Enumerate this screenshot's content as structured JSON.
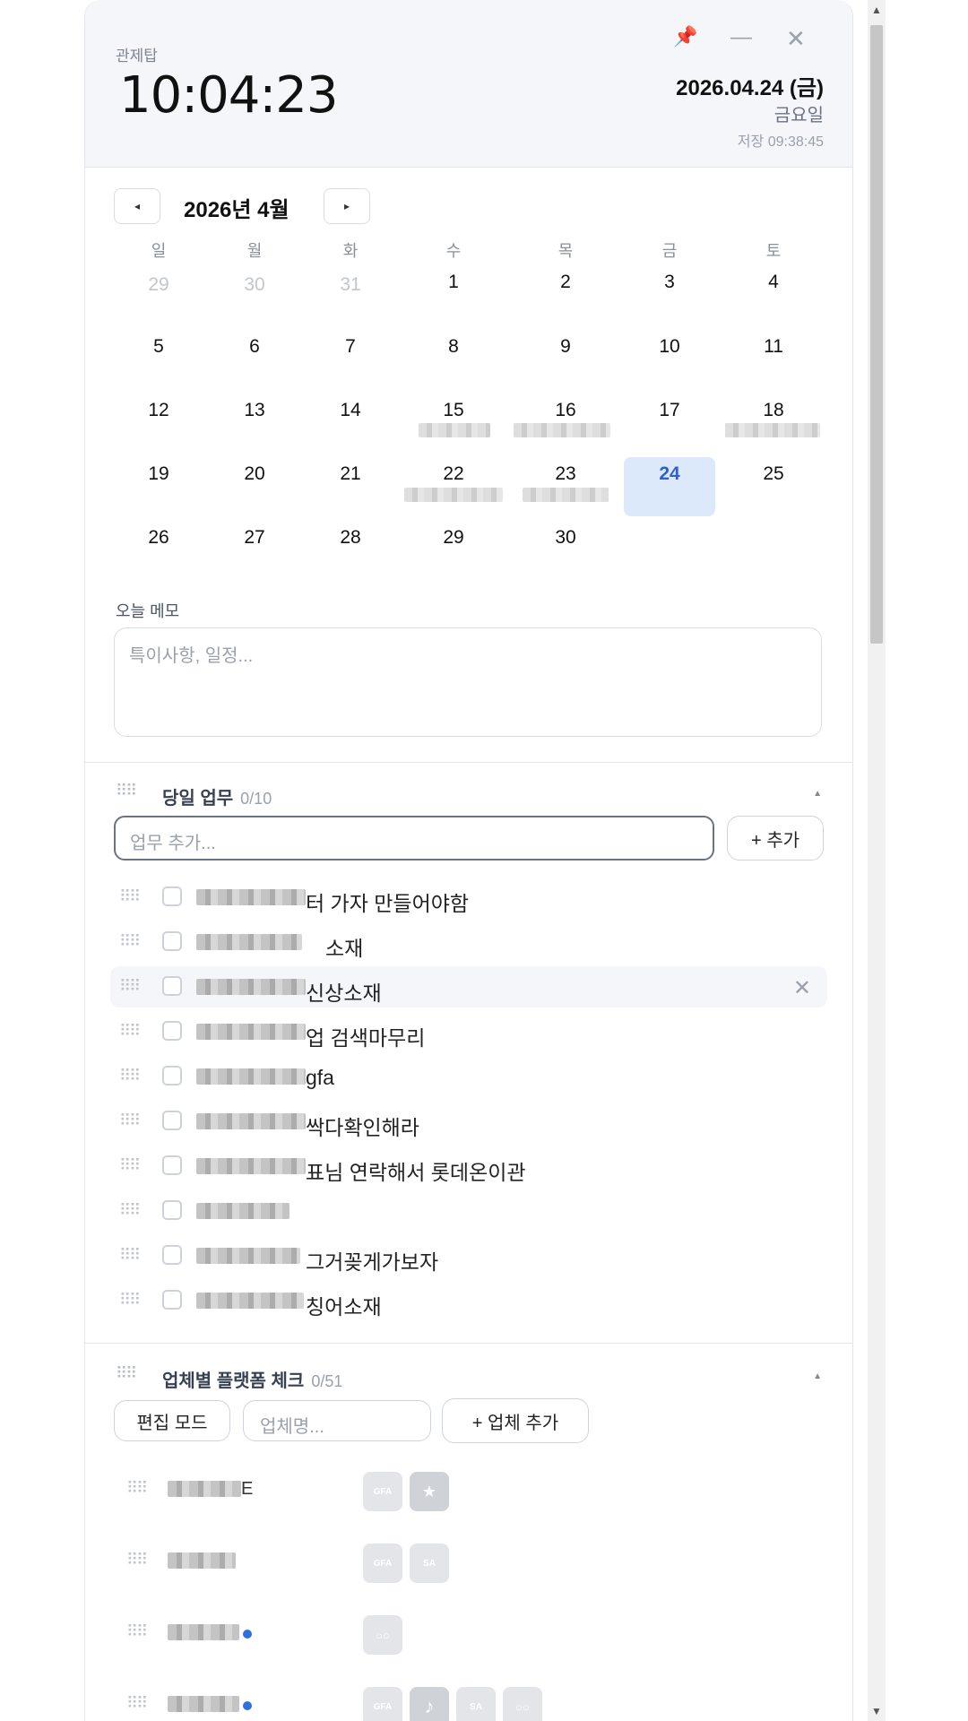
{
  "header": {
    "app_label": "관제탑",
    "clock": "10:04:23",
    "date": "2026.04.24 (금)",
    "weekday": "금요일",
    "saved": "저장 09:38:45",
    "icons": [
      "pin-icon",
      "minimize-icon",
      "close-icon"
    ]
  },
  "calendar": {
    "prev": "◂",
    "next": "▸",
    "title": "2026년 4월",
    "weekdays": [
      "일",
      "월",
      "화",
      "수",
      "목",
      "금",
      "토"
    ],
    "weeks": [
      [
        "29",
        "30",
        "31",
        "1",
        "2",
        "3",
        "4"
      ],
      [
        "5",
        "6",
        "7",
        "8",
        "9",
        "10",
        "11"
      ],
      [
        "12",
        "13",
        "14",
        "15",
        "16",
        "17",
        "18"
      ],
      [
        "19",
        "20",
        "21",
        "22",
        "23",
        "24",
        "25"
      ],
      [
        "26",
        "27",
        "28",
        "29",
        "30",
        "",
        ""
      ]
    ],
    "today": "24"
  },
  "memo": {
    "label": "오늘 메모",
    "placeholder": "특이사항, 일정..."
  },
  "tasks": {
    "title": "당일 업무",
    "count": "0/10",
    "collapse": "▲",
    "input_placeholder": "업무 추가...",
    "add_label": "+ 추가",
    "items": [
      "터 가자 만들어야함",
      "소재",
      "신상소재",
      "업 검색마무리",
      "gfa",
      "싹다확인해라",
      "표님 연락해서 롯데온이관",
      "",
      "그거꽂게가보자",
      "칭어소재"
    ],
    "remove": "✕"
  },
  "vendors": {
    "title": "업체별 플랫폼 체크",
    "count": "0/51",
    "collapse": "▲",
    "edit_label": "편집 모드",
    "input_placeholder": "업체명...",
    "add_label": "+ 업체 추가",
    "rows": [
      {
        "suffix": "E",
        "platforms": [
          "GFA",
          "★"
        ]
      },
      {
        "suffix": "",
        "platforms": [
          "GFA",
          "SA"
        ]
      },
      {
        "suffix": "",
        "platforms": [
          "○○"
        ]
      },
      {
        "suffix": "",
        "platforms": [
          "GFA",
          "♪",
          "SA",
          "○○"
        ]
      }
    ]
  },
  "colors": {
    "accent": "#2f5fd0",
    "today_bg": "#dbe9fb",
    "header_bg": "#f4f6f9",
    "pin": "#e0403a"
  }
}
